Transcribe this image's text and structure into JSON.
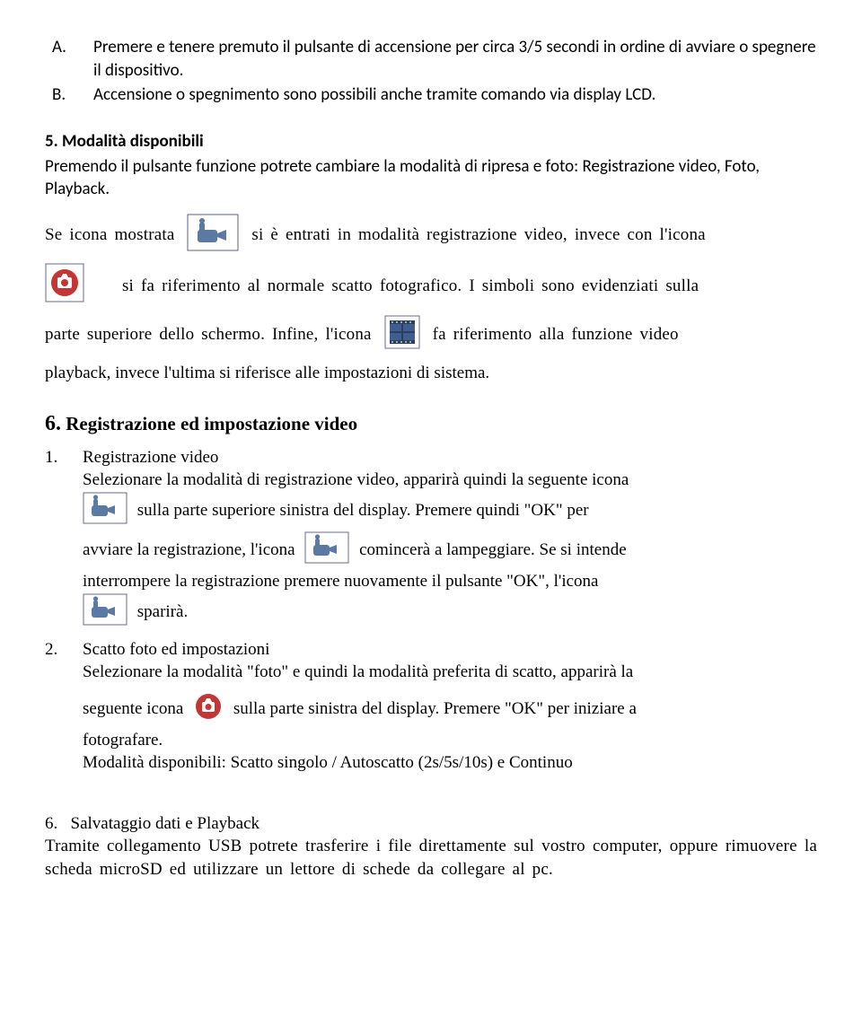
{
  "itemA": {
    "marker": "A.",
    "text": "Premere e tenere premuto il pulsante di accensione per circa 3/5 secondi in ordine di avviare o spegnere il dispositivo."
  },
  "itemB": {
    "marker": "B.",
    "text": "Accensione o spegnimento sono possibili anche tramite comando via display LCD."
  },
  "sec5": {
    "title": "5.   Modalità disponibili",
    "intro": "Premendo il pulsante funzione potrete cambiare la modalità di ripresa e foto: Registrazione video, Foto, Playback.",
    "p1a": "Se icona mostrata",
    "p1b": "si è entrati in modalità registrazione video, invece con l'icona",
    "p2a": "si fa riferimento al normale scatto fotografico. I simboli sono evidenziati sulla",
    "p3a": "parte superiore dello schermo. Infine, l'icona",
    "p3b": "fa riferimento alla funzione video",
    "p4": "playback, invece l'ultima si riferisce alle impostazioni di sistema."
  },
  "sec6": {
    "title_num": "6.",
    "title_text": " Registrazione ed impostazione video",
    "it1": {
      "marker": "1.",
      "line1": "Registrazione video",
      "line2": "Selezionare la modalità di registrazione video, apparirà quindi la seguente icona",
      "line3a": "sulla parte superiore sinistra del display. Premere quindi \"OK\" per",
      "line4a": "avviare la registrazione, l'icona",
      "line4b": "comincerà a lampeggiare. Se si intende",
      "line5": "interrompere la registrazione premere nuovamente il pulsante \"OK\", l'icona",
      "line6": "sparirà."
    },
    "it2": {
      "marker": "2.",
      "line1": "Scatto foto ed impostazioni",
      "line2": "Selezionare la modalità \"foto\" e quindi la modalità preferita di scatto, apparirà la",
      "line3a": "seguente icona",
      "line3b": "sulla parte sinistra del display. Premere \"OK\" per iniziare a",
      "line4": "fotografare.",
      "line5": "Modalità disponibili: Scatto singolo / Autoscatto (2s/5s/10s) e Continuo"
    }
  },
  "sec6b": {
    "marker": "6.",
    "title": "Salvataggio dati e Playback",
    "body": "Tramite collegamento USB potrete trasferire i file direttamente sul vostro computer, oppure rimuovere la scheda microSD ed utilizzare un lettore di schede da collegare al pc."
  }
}
